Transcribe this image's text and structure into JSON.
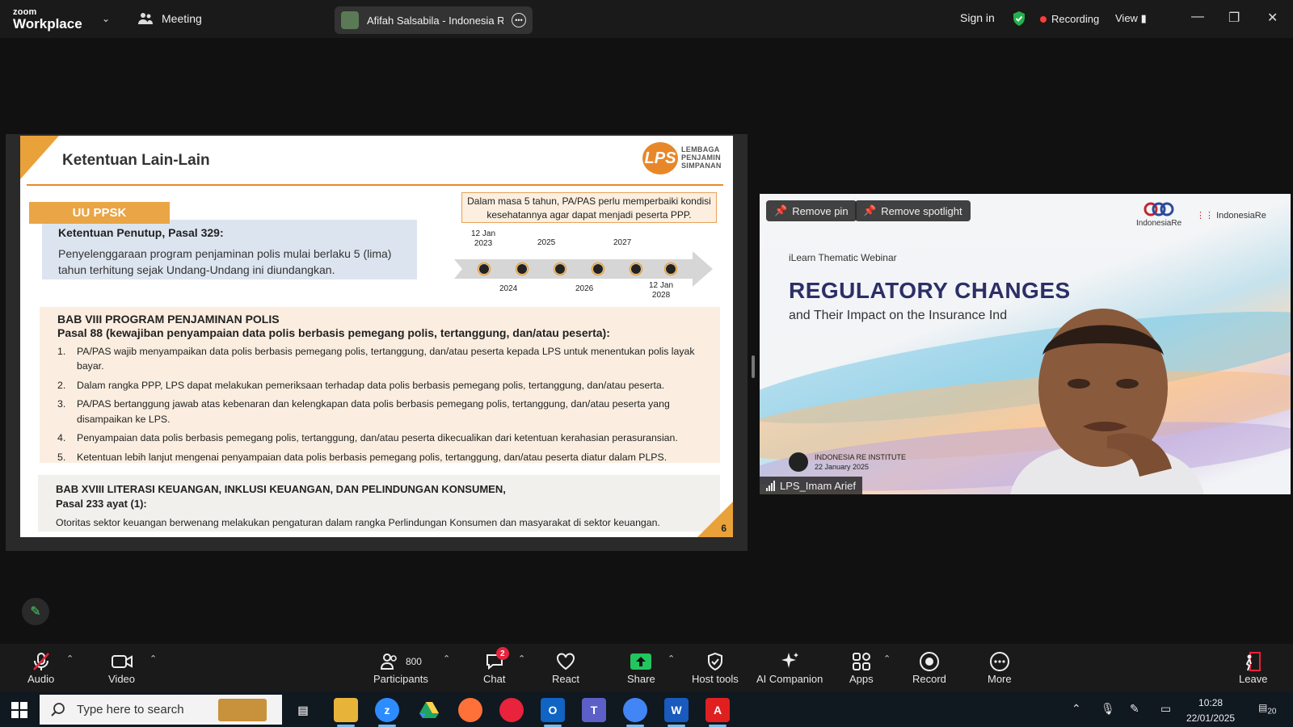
{
  "app": {
    "brand_line1": "zoom",
    "brand_line2": "Workplace",
    "meeting_label": "Meeting"
  },
  "meeting_tab": {
    "title": "Afifah Salsabila - Indonesia Re's s"
  },
  "header": {
    "sign_in": "Sign in",
    "recording": "Recording",
    "view": "View"
  },
  "slide": {
    "title": "Ketentuan Lain-Lain",
    "logo_mark": "LPS",
    "logo_text": [
      "LEMBAGA",
      "PENJAMIN",
      "SIMPANAN"
    ],
    "uu_label": "UU PPSK",
    "pasal_heading": "Ketentuan Penutup, Pasal 329:",
    "pasal_text": "Penyelenggaraan program penjaminan polis mulai berlaku 5 (lima) tahun terhitung sejak Undang-Undang ini diundangkan.",
    "note": "Dalam masa 5 tahun, PA/PAS perlu memperbaiki kondisi kesehatannya agar dapat menjadi peserta PPP.",
    "timeline": {
      "top_labels": [
        "12 Jan\n2023",
        "2025",
        "2027"
      ],
      "bottom_labels": [
        "2024",
        "2026",
        "12 Jan\n2028"
      ]
    },
    "bab8_heading": "BAB VIII PROGRAM PENJAMINAN POLIS",
    "bab8_sub": "Pasal 88 (kewajiban penyampaian data polis berbasis pemegang polis, tertanggung, dan/atau peserta):",
    "bab8_items": [
      {
        "n": "1.",
        "text": "PA/PAS wajib menyampaikan data polis berbasis pemegang polis, tertanggung, dan/atau peserta kepada LPS untuk menentukan polis layak bayar."
      },
      {
        "n": "2.",
        "text": "Dalam rangka PPP, LPS dapat melakukan pemeriksaan terhadap data polis berbasis pemegang polis, tertanggung, dan/atau peserta."
      },
      {
        "n": "3.",
        "text": "PA/PAS bertanggung jawab atas kebenaran dan kelengkapan data polis berbasis pemegang polis, tertanggung, dan/atau peserta yang disampaikan ke LPS."
      },
      {
        "n": "4.",
        "text": "Penyampaian data polis berbasis pemegang polis, tertanggung, dan/atau peserta dikecualikan dari ketentuan kerahasian perasuransian."
      },
      {
        "n": "5.",
        "text": "Ketentuan lebih lanjut mengenai penyampaian data polis berbasis pemegang polis, tertanggung, dan/atau peserta diatur dalam PLPS."
      }
    ],
    "bab18_heading": "BAB XVIII LITERASI KEUANGAN, INKLUSI KEUANGAN, DAN PELINDUNGAN KONSUMEN,",
    "bab18_sub": "Pasal 233 ayat (1):",
    "bab18_text": "Otoritas sektor keuangan berwenang melakukan pengaturan dalam rangka Perlindungan Konsumen dan masyarakat di sektor keuangan.",
    "page_number": "6"
  },
  "video": {
    "remove_pin": "Remove pin",
    "remove_spotlight": "Remove spotlight",
    "webinar_label": "iLearn Thematic Webinar",
    "headline": "REGULATORY CHANGES",
    "subheadline": "and Their Impact on the Insurance Ind",
    "logo_left": "IndonesiaRe",
    "logo_right": "IndonesiaRe",
    "institute_name": "INDONESIA RE INSTITUTE",
    "institute_date": "22 January 2025",
    "participant_name": "LPS_Imam Arief"
  },
  "toolbar": {
    "audio": "Audio",
    "video": "Video",
    "participants": "Participants",
    "participants_count": "800",
    "chat": "Chat",
    "chat_badge": "2",
    "react": "React",
    "share": "Share",
    "host_tools": "Host tools",
    "ai_companion": "AI Companion",
    "apps": "Apps",
    "record": "Record",
    "more": "More",
    "leave": "Leave"
  },
  "taskbar": {
    "search_placeholder": "Type here to search",
    "time": "10:28",
    "date": "22/01/2025",
    "notification_count": "20"
  },
  "colors": {
    "accent_orange": "#e9a13a",
    "share_green": "#22c55e",
    "leave_red": "#e8233b"
  }
}
